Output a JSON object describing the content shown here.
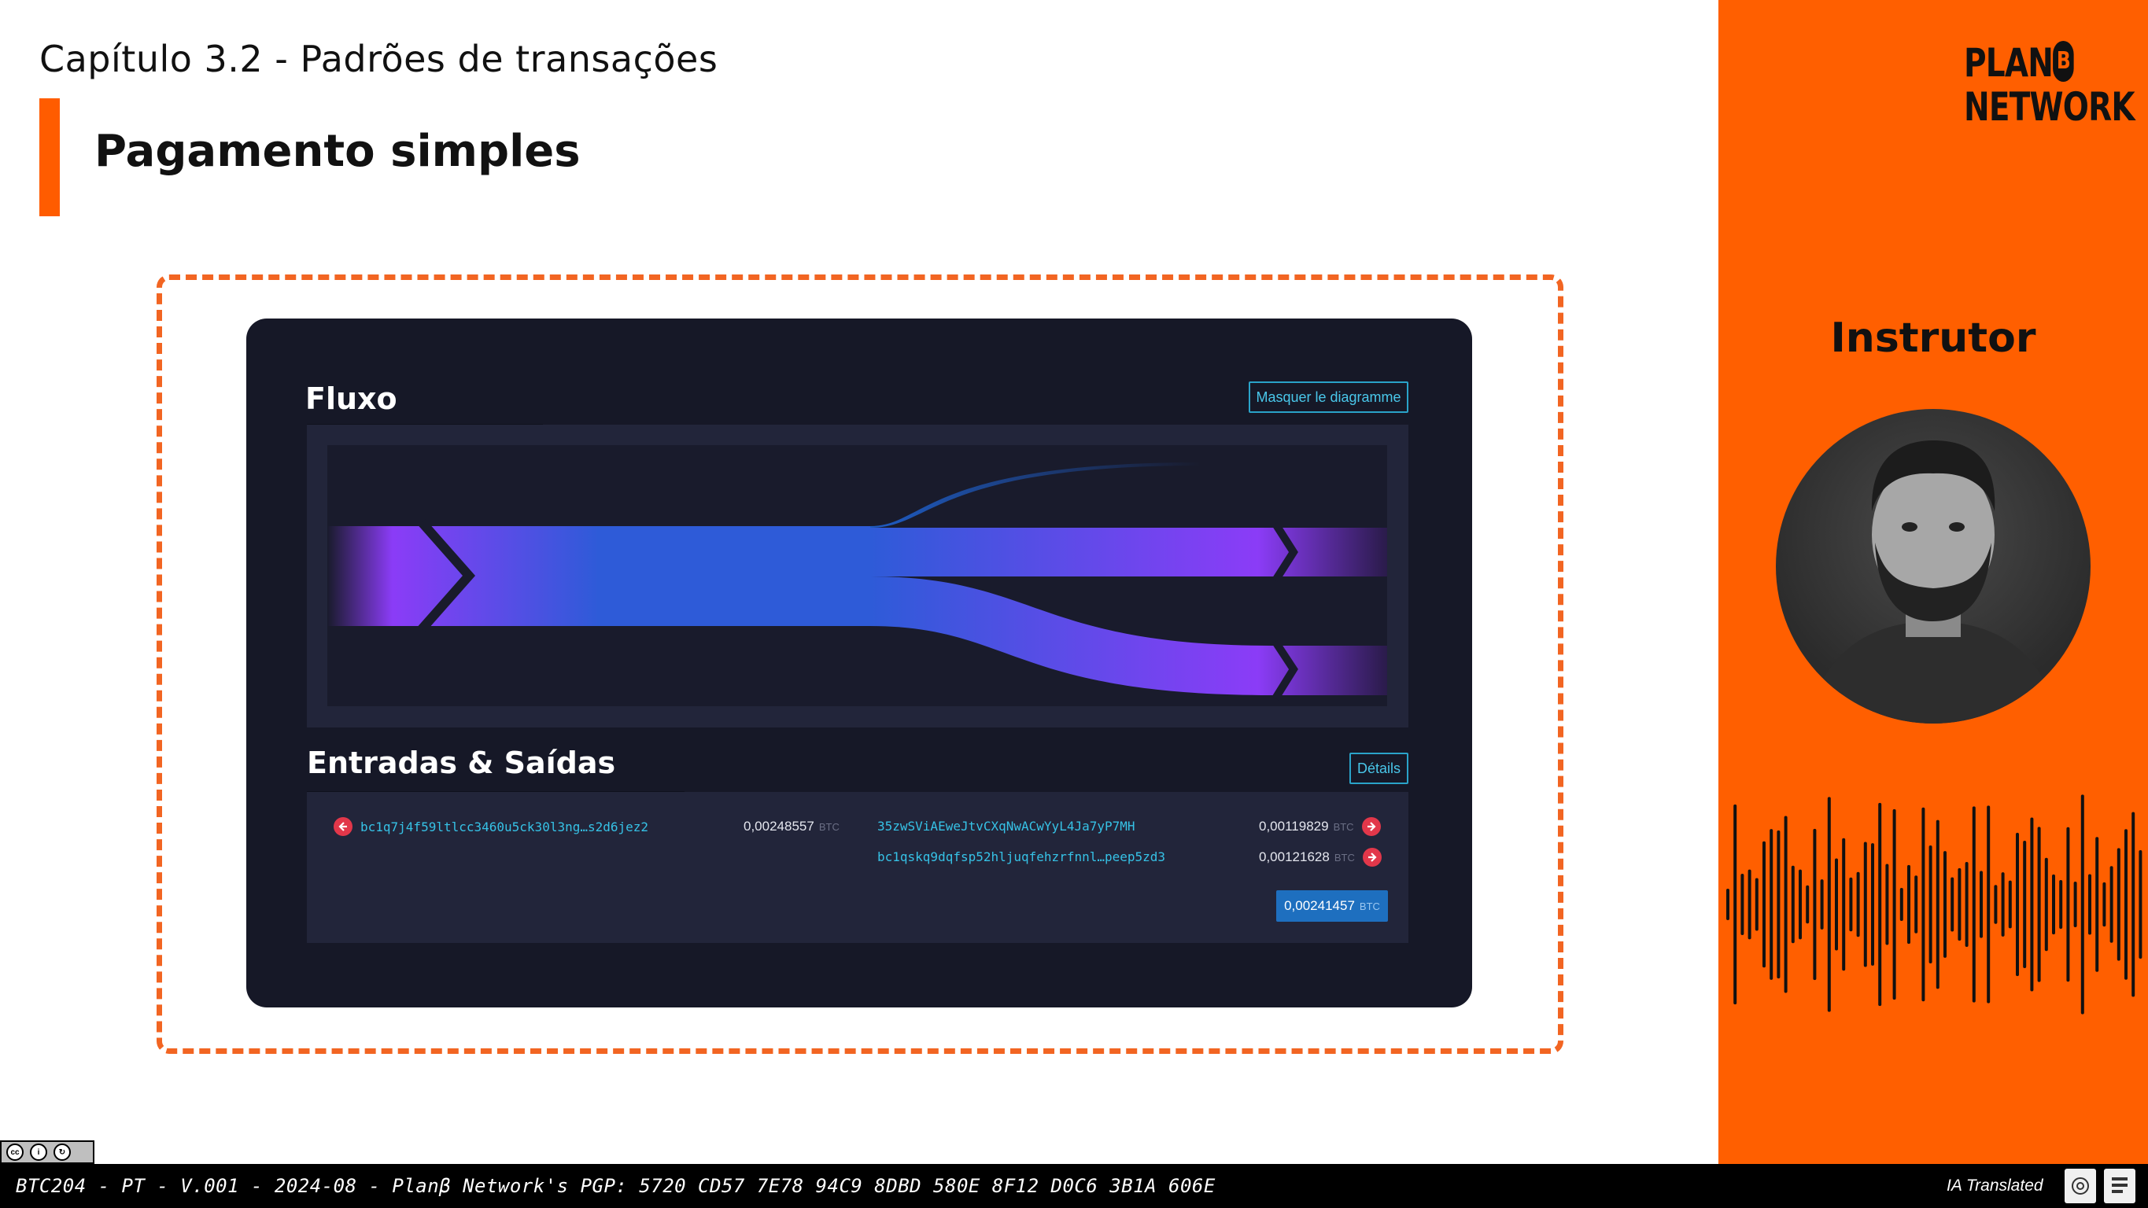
{
  "slide": {
    "chapter": "Capítulo 3.2 - Padrões de transações",
    "title": "Pagamento simples"
  },
  "screen": {
    "flow_title": "Fluxo",
    "hide_diagram_button": "Masquer le diagramme",
    "io_title": "Entradas & Saídas",
    "details_button": "Détails",
    "inputs": [
      {
        "address": "bc1q7j4f59ltlcc3460u5ck30l3ng…s2d6jez2",
        "amount": "0,00248557",
        "unit": "BTC"
      }
    ],
    "outputs": [
      {
        "address": "35zwSViAEweJtvCXqNwACwYyL4Ja7yP7MH",
        "amount": "0,00119829",
        "unit": "BTC"
      },
      {
        "address": "bc1qskq9dqfsp52hljuqfehzrfnnl…peep5zd3",
        "amount": "0,00121628",
        "unit": "BTC"
      }
    ],
    "total": {
      "amount": "0,00241457",
      "unit": "BTC"
    }
  },
  "side": {
    "logo_line1": "PLAN",
    "logo_b": "B",
    "logo_line2": "NETWORK",
    "instructor_label": "Instrutor"
  },
  "footer": {
    "text": "BTC204 - PT - V.001 - 2024-08 - Planβ Network's PGP: 5720 CD57 7E78 94C9 8DBD 580E 8F12 D0C6 3B1A 606E",
    "ia_label": "IA Translated",
    "license_icons": [
      "cc-icon",
      "by-icon",
      "sa-icon"
    ]
  },
  "colors": {
    "accent": "#ff5f00",
    "screen_bg": "#161827",
    "flow_purple": "#8b3cf7",
    "flow_blue": "#2e5bd8",
    "address_cyan": "#36c2e6",
    "input_arrow_red": "#e2374a"
  }
}
